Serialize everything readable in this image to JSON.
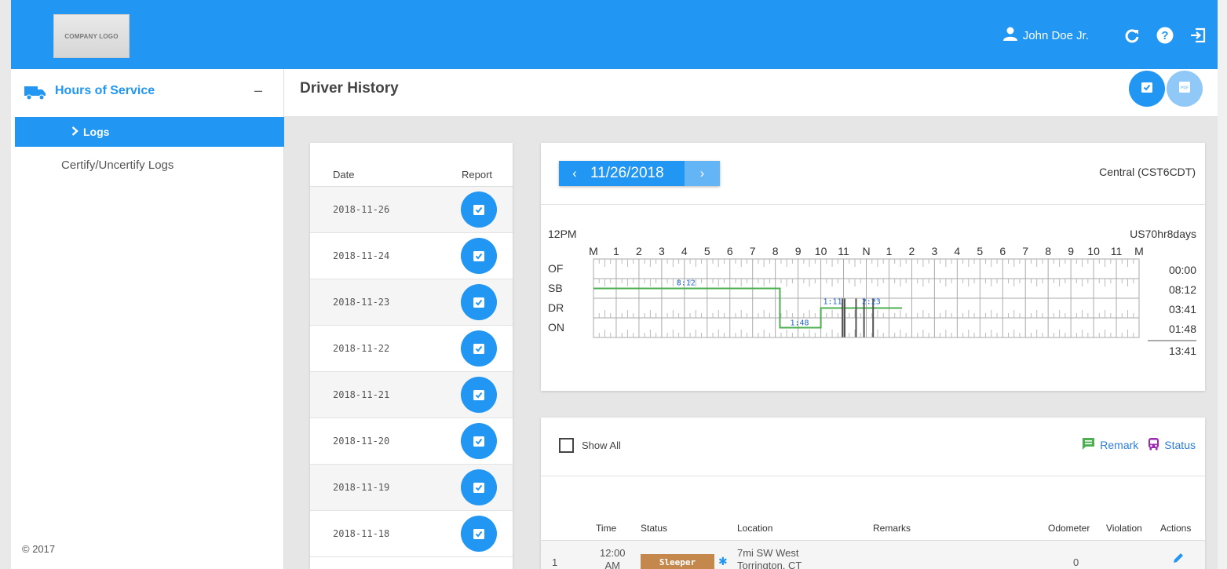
{
  "header": {
    "logo_text": "COMPANY LOGO",
    "user_name": "John Doe Jr.",
    "icons": [
      "user-icon",
      "refresh-icon",
      "help-icon",
      "logout-icon"
    ]
  },
  "sidebar": {
    "section_title": "Hours of Service",
    "collapse_symbol": "–",
    "items": [
      {
        "label": "Logs",
        "active": true
      },
      {
        "label": "Certify/Uncertify Logs",
        "active": false
      }
    ],
    "footer": "© 2017"
  },
  "page": {
    "title": "Driver History",
    "buttons": [
      "certify-icon",
      "pdf-icon"
    ]
  },
  "date_list": {
    "headers": {
      "date": "Date",
      "report": "Report"
    },
    "rows": [
      "2018-11-26",
      "2018-11-24",
      "2018-11-23",
      "2018-11-22",
      "2018-11-21",
      "2018-11-20",
      "2018-11-19",
      "2018-11-18"
    ]
  },
  "chart": {
    "date": "11/26/2018",
    "timezone": "Central (CST6CDT)",
    "corner_label": "12PM",
    "ruleset": "US70hr8days",
    "hour_labels": [
      "M",
      "1",
      "2",
      "3",
      "4",
      "5",
      "6",
      "7",
      "8",
      "9",
      "10",
      "11",
      "N",
      "1",
      "2",
      "3",
      "4",
      "5",
      "6",
      "7",
      "8",
      "9",
      "10",
      "11",
      "M"
    ],
    "row_labels": [
      "OF",
      "SB",
      "DR",
      "ON"
    ],
    "totals": [
      "00:00",
      "08:12",
      "03:41",
      "01:48"
    ],
    "grand_total": "13:41",
    "duration_labels": {
      "sb": "8:12",
      "on": "1:48",
      "dr1": "1:11",
      "dr2": "2:23"
    },
    "colors": {
      "line": "#4caf50",
      "label": "#2166d1",
      "grid": "#aaaaaa"
    }
  },
  "chart_data": {
    "type": "line",
    "title": "",
    "x_unit": "hours since midnight",
    "rows": [
      "OF",
      "SB",
      "DR",
      "ON"
    ],
    "segments": [
      {
        "status": "SB",
        "start": 0.0,
        "end": 8.2
      },
      {
        "status": "ON",
        "start": 8.2,
        "end": 10.0
      },
      {
        "status": "DR",
        "start": 10.0,
        "end": 11.18
      },
      {
        "status": "DR",
        "start": 11.18,
        "end": 13.57
      }
    ],
    "totals": {
      "OF": "00:00",
      "SB": "08:12",
      "DR": "03:41",
      "ON": "01:48"
    },
    "grand_total": "13:41",
    "xlim": [
      0,
      24
    ]
  },
  "events": {
    "show_all_label": "Show All",
    "legend": [
      {
        "label": "Remark",
        "icon": "remark-icon",
        "color": "#4caf50"
      },
      {
        "label": "Status",
        "icon": "bus-icon",
        "color": "#9c27b0"
      }
    ],
    "headers": {
      "time": "Time",
      "status": "Status",
      "location": "Location",
      "remarks": "Remarks",
      "odometer": "Odometer",
      "violation": "Violation",
      "actions": "Actions"
    },
    "rows": [
      {
        "num": "1",
        "time_line1": "12:00",
        "time_line2": "AM",
        "status": "Sleeper",
        "location_line1": "7mi SW West",
        "location_line2": "Torrington, CT",
        "odometer": "0"
      }
    ]
  }
}
